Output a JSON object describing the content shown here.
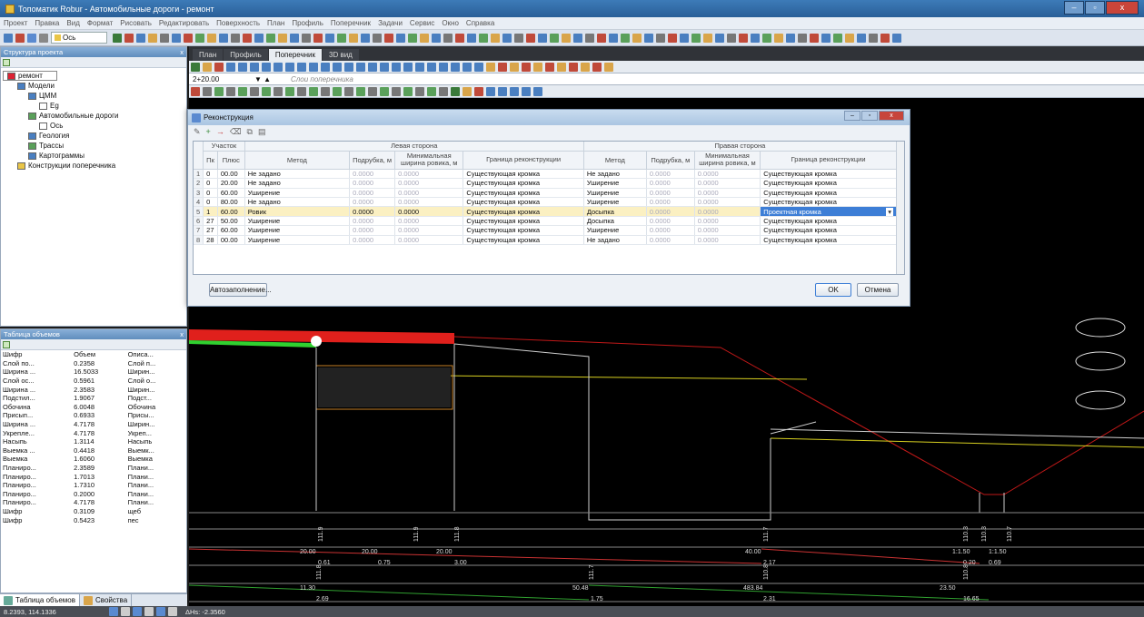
{
  "app": {
    "title": "Топоматик Robur - Автомобильные дороги - ремонт",
    "window_buttons": [
      "–",
      "▫",
      "x"
    ]
  },
  "menu": [
    "Проект",
    "Правка",
    "Вид",
    "Формат",
    "Рисовать",
    "Редактировать",
    "Поверхность",
    "План",
    "Профиль",
    "Поперечник",
    "Задачи",
    "Сервис",
    "Окно",
    "Справка"
  ],
  "toolbar": {
    "layer_select": "Ось"
  },
  "structure_panel": {
    "title": "Структура проекта",
    "close": "x",
    "tree": [
      {
        "label": "ремонт",
        "level": 0,
        "icon": "project-icon"
      },
      {
        "label": "Модели",
        "level": 1,
        "icon": "models-icon"
      },
      {
        "label": "ЦММ",
        "level": 2,
        "icon": "dtm-icon"
      },
      {
        "label": "Eg",
        "level": 3,
        "icon": "file-icon"
      },
      {
        "label": "Автомобильные дороги",
        "level": 2,
        "icon": "road-icon"
      },
      {
        "label": "Ось",
        "level": 3,
        "icon": "file-icon"
      },
      {
        "label": "Геология",
        "level": 2,
        "icon": "geology-icon"
      },
      {
        "label": "Трассы",
        "level": 2,
        "icon": "route-icon"
      },
      {
        "label": "Картограммы",
        "level": 2,
        "icon": "cartogram-icon"
      },
      {
        "label": "Конструкции поперечника",
        "level": 1,
        "icon": "folder-icon"
      }
    ]
  },
  "volumes_panel": {
    "title": "Таблица объемов",
    "close": "x",
    "headers": [
      "Шифр",
      "Объем",
      "Описа..."
    ],
    "rows": [
      [
        "Слой по...",
        "0.2358",
        "Слой п..."
      ],
      [
        "Ширина ...",
        "16.5033",
        "Ширин..."
      ],
      [
        "Слой ос...",
        "0.5961",
        "Слой о..."
      ],
      [
        "Ширина ...",
        "2.3583",
        "Ширин..."
      ],
      [
        "Подстил...",
        "1.9067",
        "Подст..."
      ],
      [
        "Обочина",
        "6.0048",
        "Обочина"
      ],
      [
        "Присып...",
        "0.6933",
        "Присы..."
      ],
      [
        "Ширина ...",
        "4.7178",
        "Ширин..."
      ],
      [
        "Укрепле...",
        "4.7178",
        "Укреп..."
      ],
      [
        "Насыпь",
        "1.3114",
        "Насыпь"
      ],
      [
        "Выемка ...",
        "0.4418",
        "Выемк..."
      ],
      [
        "Выемка",
        "1.6060",
        "Выемка"
      ],
      [
        "Планиро...",
        "2.3589",
        "Плани..."
      ],
      [
        "Планиро...",
        "1.7013",
        "Плани..."
      ],
      [
        "Планиро...",
        "1.7310",
        "Плани..."
      ],
      [
        "Планиро...",
        "0.2000",
        "Плани..."
      ],
      [
        "Планиро...",
        "4.7178",
        "Плани..."
      ],
      [
        "Шифр",
        "0.3109",
        "щеб"
      ],
      [
        "Шифр",
        "0.5423",
        "пес"
      ]
    ]
  },
  "bottom_tabs": [
    "Таблица объемов",
    "Свойства"
  ],
  "doc_tabs": [
    "План",
    "Профиль",
    "Поперечник",
    "3D вид"
  ],
  "station": {
    "value": "2+20.00",
    "layers_placeholder": "Слои поперечника"
  },
  "dialog": {
    "title": "Реконструкция",
    "group_left": "Левая сторона",
    "group_right": "Правая сторона",
    "group_station": "Участок",
    "col_pk": "Пк",
    "col_plus": "Плюс",
    "col_method": "Метод",
    "col_undercut": "Подрубка, м",
    "col_minwidth": "Минимальная ширина ровика, м",
    "col_boundary": "Граница реконструкции",
    "rows": [
      {
        "n": "1",
        "pk": "0",
        "plus": "00.00",
        "lm": "Не задано",
        "lu": "0.0000",
        "lw": "0.0000",
        "lb": "Существующая кромка",
        "rm": "Не задано",
        "ru": "0.0000",
        "rw": "0.0000",
        "rb": "Существующая кромка"
      },
      {
        "n": "2",
        "pk": "0",
        "plus": "20.00",
        "lm": "Не задано",
        "lu": "0.0000",
        "lw": "0.0000",
        "lb": "Существующая кромка",
        "rm": "Уширение",
        "ru": "0.0000",
        "rw": "0.0000",
        "rb": "Существующая кромка"
      },
      {
        "n": "3",
        "pk": "0",
        "plus": "60.00",
        "lm": "Уширение",
        "lu": "0.0000",
        "lw": "0.0000",
        "lb": "Существующая кромка",
        "rm": "Уширение",
        "ru": "0.0000",
        "rw": "0.0000",
        "rb": "Существующая кромка"
      },
      {
        "n": "4",
        "pk": "0",
        "plus": "80.00",
        "lm": "Не задано",
        "lu": "0.0000",
        "lw": "0.0000",
        "lb": "Существующая кромка",
        "rm": "Уширение",
        "ru": "0.0000",
        "rw": "0.0000",
        "rb": "Существующая кромка"
      },
      {
        "n": "5",
        "pk": "1",
        "plus": "60.00",
        "lm": "Ровик",
        "lu": "0.0000",
        "lw": "0.0000",
        "lb": "Существующая кромка",
        "rm": "Досыпка",
        "ru": "0.0000",
        "rw": "0.0000",
        "rb": "Проектная кромка"
      },
      {
        "n": "6",
        "pk": "27",
        "plus": "50.00",
        "lm": "Уширение",
        "lu": "0.0000",
        "lw": "0.0000",
        "lb": "Существующая кромка",
        "rm": "Досыпка",
        "ru": "0.0000",
        "rw": "0.0000",
        "rb": "Существующая кромка"
      },
      {
        "n": "7",
        "pk": "27",
        "plus": "60.00",
        "lm": "Уширение",
        "lu": "0.0000",
        "lw": "0.0000",
        "lb": "Существующая кромка",
        "rm": "Уширение",
        "ru": "0.0000",
        "rw": "0.0000",
        "rb": "Существующая кромка"
      },
      {
        "n": "8",
        "pk": "28",
        "plus": "00.00",
        "lm": "Уширение",
        "lu": "0.0000",
        "lw": "0.0000",
        "lb": "Существующая кромка",
        "rm": "Не задано",
        "ru": "0.0000",
        "rw": "0.0000",
        "rb": "Существующая кромка"
      }
    ],
    "autofill": "Автозаполнение...",
    "ok": "OK",
    "cancel": "Отмена"
  },
  "drawing_labels": {
    "top_verticals": [
      "111.9",
      "111.9",
      "111.8",
      "111.7",
      "110.3",
      "110.3",
      "110.7"
    ],
    "row1": [
      "20.00",
      "20.00",
      "20.00",
      "40.00",
      "1:1.50",
      "1:1.50"
    ],
    "row1_sub": [
      "0.61",
      "0.75",
      "3.00",
      "2.17",
      "0.20",
      "0.69"
    ],
    "mid_verticals": [
      "111.8",
      "111.7",
      "110.8",
      "110.8"
    ],
    "row2": [
      "11.30",
      "50.48",
      "483.84",
      "23.50"
    ],
    "row2_sub": [
      "2.69",
      "1.75",
      "2.31",
      "16.65"
    ]
  },
  "status": {
    "coords": "8.2393, 114.1336",
    "dh": "ΔHs: -2.3560"
  },
  "colors": {
    "road_red": "#e0201c",
    "road_green": "#30d030",
    "line_red": "#c01818",
    "line_yellow": "#d8d020",
    "line_white": "#e0e0e0"
  }
}
